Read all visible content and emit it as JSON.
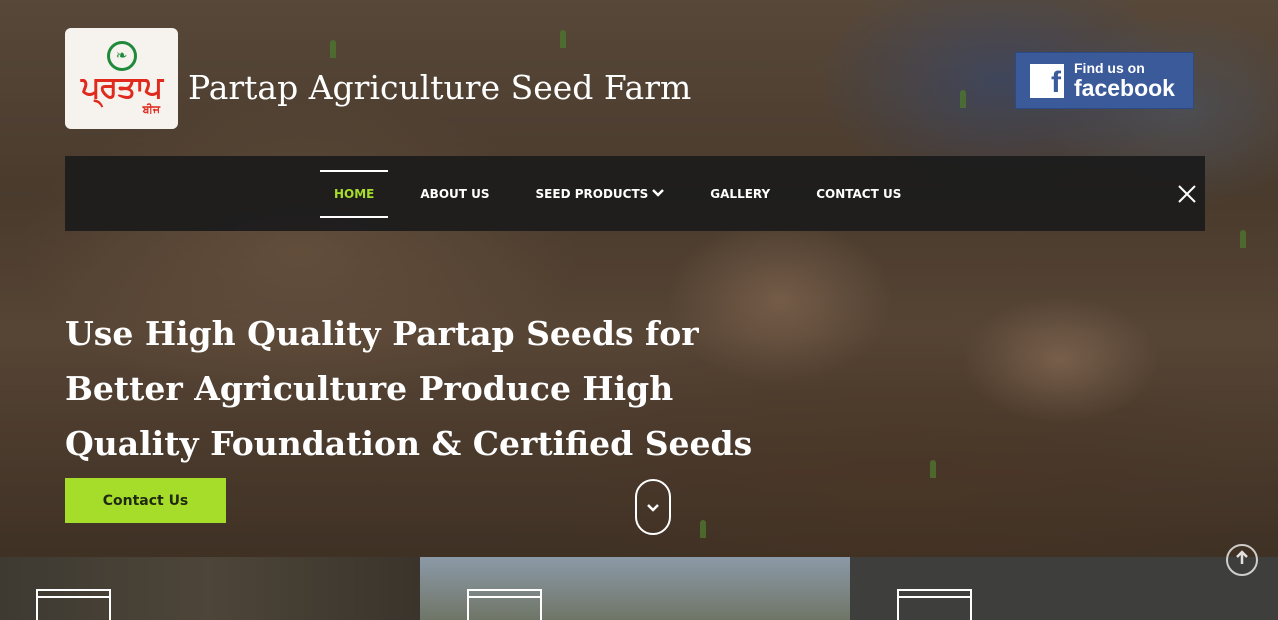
{
  "logo": {
    "main_text": "ਪ੍ਰਤਾਪ",
    "sub_text": "ਬੀਜ"
  },
  "site_title": "Partap Agriculture Seed Farm",
  "facebook": {
    "line1": "Find us on",
    "line2": "facebook",
    "icon": "facebook-f-icon"
  },
  "nav": {
    "items": [
      {
        "label": "HOME",
        "active": true
      },
      {
        "label": "ABOUT US",
        "active": false
      },
      {
        "label": "SEED PRODUCTS",
        "active": false,
        "has_dropdown": true
      },
      {
        "label": "GALLERY",
        "active": false
      },
      {
        "label": "CONTACT US",
        "active": false
      }
    ],
    "close_icon": "close-icon"
  },
  "hero": {
    "headline": "Use High Quality Partap Seeds for Better Agriculture Produce High Quality Foundation & Certified Seeds",
    "cta_label": "Contact Us"
  },
  "colors": {
    "accent": "#a6dd2b",
    "nav_bg": "#1c1c1c",
    "facebook_blue": "#3b5a9a",
    "logo_red": "#e02a1e",
    "logo_green": "#1f8a3a"
  }
}
